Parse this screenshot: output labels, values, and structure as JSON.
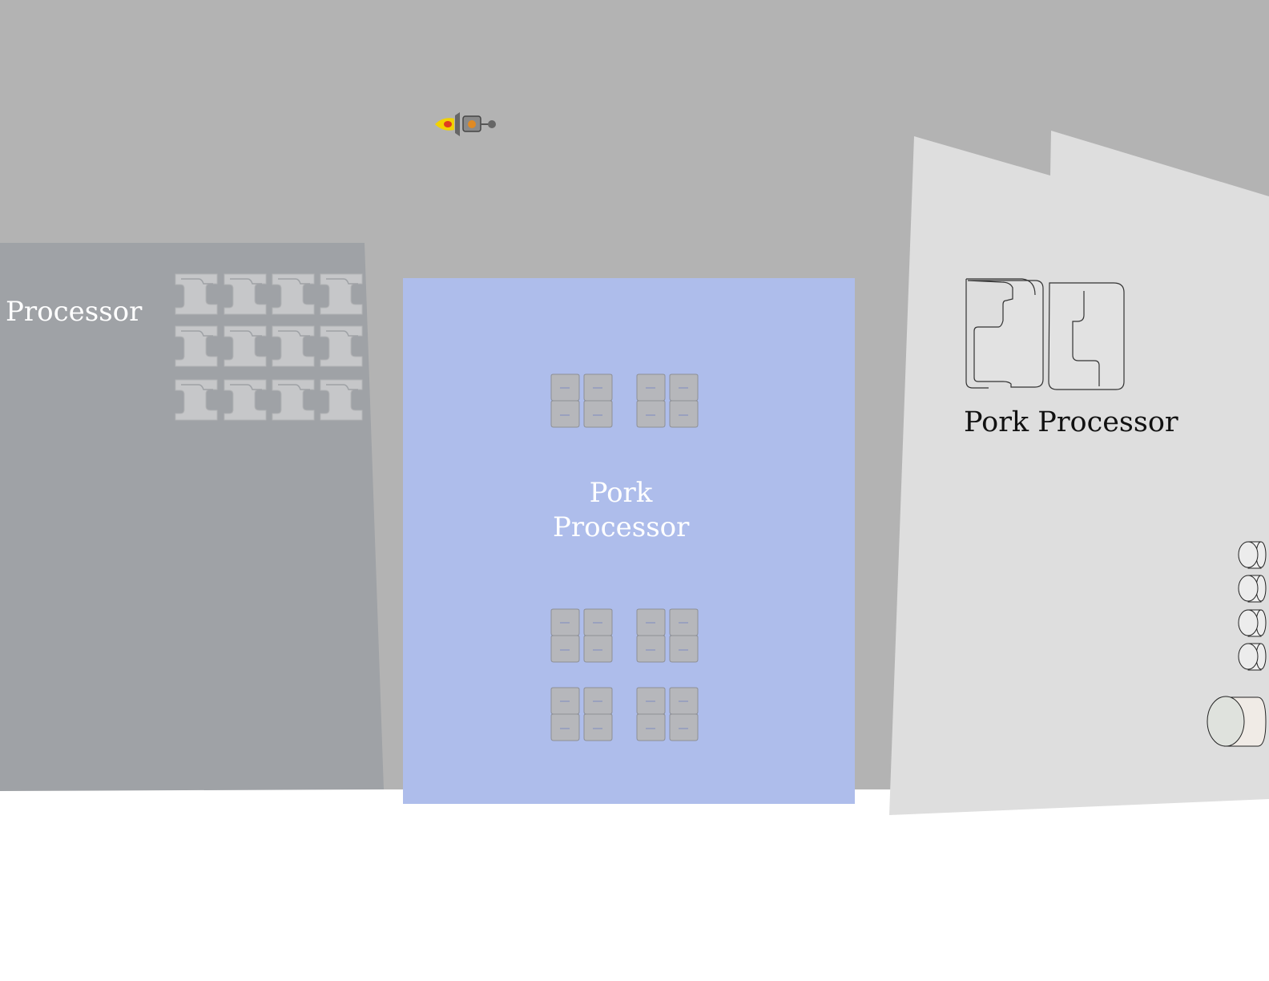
{
  "scene": {
    "colors": {
      "sky": "#b3b3b3",
      "ground": "#ffffff",
      "left_building": "#9fa2a6",
      "center_building": "#aebdeb",
      "right_building": "#dedede",
      "flame": "#f2d200"
    },
    "left_building": {
      "label": "Processor"
    },
    "center_building": {
      "label_line1": "Pork",
      "label_line2": "Processor"
    },
    "right_building": {
      "label": "Pork Processor"
    },
    "icons": [
      "flying-lantern-icon",
      "meat-slab-icon",
      "cylinder-tank-icon",
      "chop-block-icon"
    ]
  }
}
